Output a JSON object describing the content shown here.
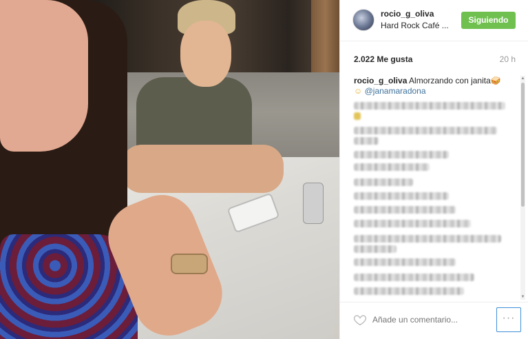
{
  "post": {
    "username": "rocio_g_oliva",
    "location": "Hard Rock Café ...",
    "follow_label": "Siguiendo",
    "likes": "2.022 Me gusta",
    "time": "20 h",
    "caption_username": "rocio_g_oliva",
    "caption_text": "Almorzando con janita🥪",
    "caption_mention": "@janamaradona",
    "comment_placeholder": "Añade un comentario...",
    "more_label": "···"
  },
  "colors": {
    "follow_green": "#70c050",
    "mention_blue": "#3f729b",
    "focus_blue": "#3f8fd8"
  },
  "icons": [
    "heart-icon",
    "more-options-icon"
  ]
}
